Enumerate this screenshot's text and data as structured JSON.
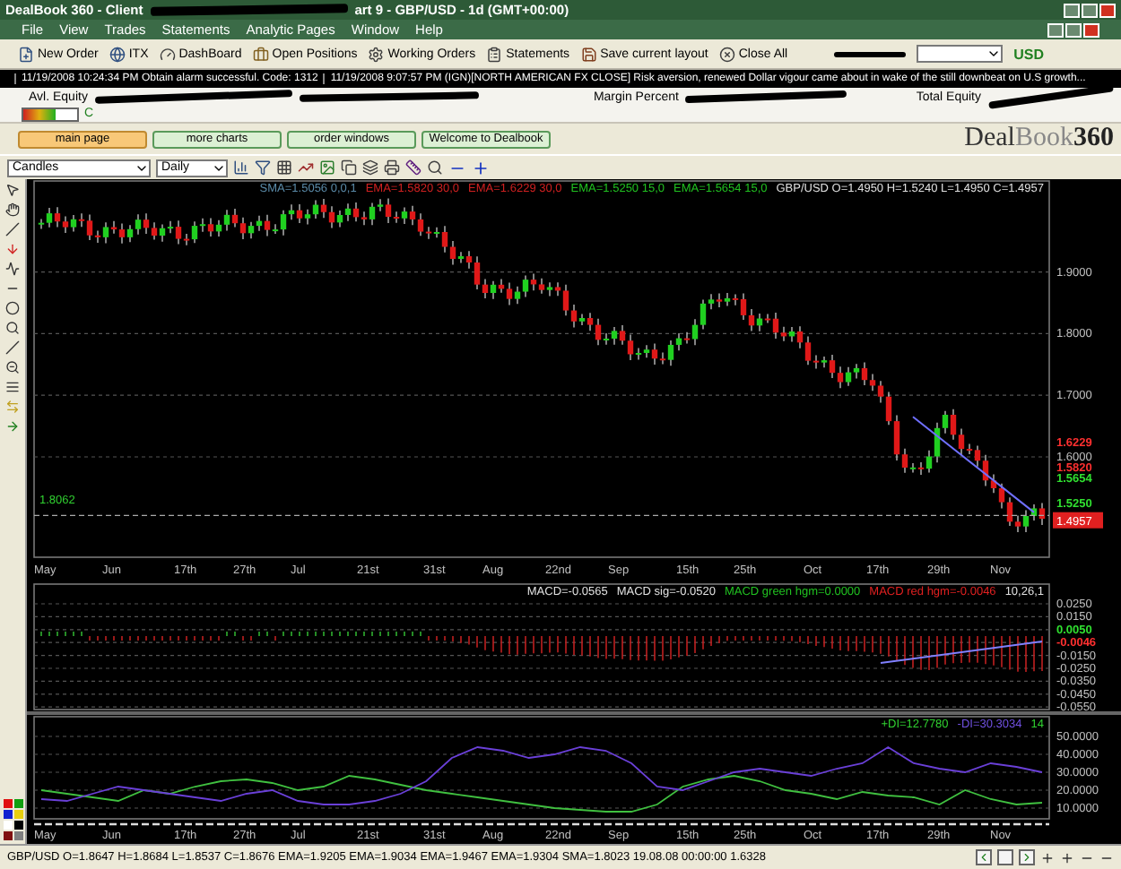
{
  "window": {
    "title_left": "DealBook 360 - Client",
    "title_right": "art 9 - GBP/USD - 1d (GMT+00:00)"
  },
  "menu": [
    "File",
    "View",
    "Trades",
    "Statements",
    "Analytic Pages",
    "Window",
    "Help"
  ],
  "toolbar": [
    {
      "label": "New Order",
      "kind": "order"
    },
    {
      "label": "ITX",
      "kind": "globe"
    },
    {
      "label": "DashBoard",
      "kind": "gauge"
    },
    {
      "label": "Open Positions",
      "kind": "briefcase"
    },
    {
      "label": "Working Orders",
      "kind": "gear"
    },
    {
      "label": "Statements",
      "kind": "clipboard"
    },
    {
      "label": "Save current layout",
      "kind": "save"
    },
    {
      "label": "Close All",
      "kind": "close"
    }
  ],
  "currency": "USD",
  "news": [
    "11/19/2008 10:24:34 PM Obtain alarm successful. Code: 1312",
    "11/19/2008 9:07:57 PM (IGN)[NORTH AMERICAN FX CLOSE] Risk aversion, renewed Dollar vigour came      about in wake of the still downbeat on U.S growth..."
  ],
  "account": {
    "left": [
      "Avl. Equity",
      "Margin Percent"
    ],
    "right": "Total Equity"
  },
  "connection": {
    "level": 0.6,
    "letter": "C"
  },
  "pages": [
    {
      "label": "main page",
      "selected": true
    },
    {
      "label": "more charts",
      "selected": false
    },
    {
      "label": "order windows",
      "selected": false
    },
    {
      "label": "Welcome to Dealbook",
      "selected": false
    }
  ],
  "logo": {
    "a": "Deal",
    "b": "Book",
    "c": "360"
  },
  "chart_toolbar": {
    "chart_type": "Candles",
    "period": "Daily"
  },
  "palette": [
    {
      "color": "#e01010"
    },
    {
      "color": "#10a010"
    },
    {
      "color": "#1020d0"
    },
    {
      "color": "#e8d010"
    },
    {
      "color": "#ffffff"
    },
    {
      "color": "#000000"
    },
    {
      "color": "#801010"
    },
    {
      "color": "#808080"
    }
  ],
  "price_chart": {
    "legend": [
      {
        "text": "SMA=1.5056 0,0,1",
        "color": "#5a8aa8"
      },
      {
        "text": "EMA=1.5820 30,0",
        "color": "#d02020"
      },
      {
        "text": "EMA=1.6229 30,0",
        "color": "#d02020"
      },
      {
        "text": "EMA=1.5250 15,0",
        "color": "#20c020"
      },
      {
        "text": "EMA=1.5654 15,0",
        "color": "#20c020"
      },
      {
        "text": "GBP/USD O=1.4950 H=1.5240 L=1.4950 C=1.4957",
        "color": "#e0e0e0"
      }
    ],
    "y_labels": [
      {
        "text": "1.9000",
        "kind": "grid"
      },
      {
        "text": "1.8000",
        "kind": "grid"
      },
      {
        "text": "1.7000",
        "kind": "grid"
      },
      {
        "text": "1.6229",
        "kind": "tag",
        "color": "#ff3030"
      },
      {
        "text": "1.6000",
        "kind": "grid"
      },
      {
        "text": "1.5820",
        "kind": "tag",
        "color": "#ff3030"
      },
      {
        "text": "1.5654",
        "kind": "tag",
        "color": "#30e030"
      },
      {
        "text": "1.5250",
        "kind": "tag",
        "color": "#30e030"
      },
      {
        "text": "1.4957",
        "kind": "box",
        "color": "#e02020"
      }
    ],
    "left_label": "1.8062",
    "x_labels": [
      "May",
      "Jun",
      "17th",
      "27th",
      "Jul",
      "21st",
      "31st",
      "Aug",
      "22nd",
      "Sep",
      "15th",
      "25th",
      "Oct",
      "17th",
      "29th",
      "Nov"
    ]
  },
  "macd_chart": {
    "legend": [
      {
        "text": "MACD=-0.0565",
        "color": "#e0e0e0"
      },
      {
        "text": "MACD sig=-0.0520",
        "color": "#e0e0e0"
      },
      {
        "text": "MACD green hgm=0.0000",
        "color": "#20c020"
      },
      {
        "text": "MACD red hgm=-0.0046",
        "color": "#e02020"
      },
      {
        "text": "10,26,1",
        "color": "#e0e0e0"
      }
    ],
    "y_labels": [
      {
        "text": "0.0250",
        "kind": "grid"
      },
      {
        "text": "0.0150",
        "kind": "grid"
      },
      {
        "text": "0.0050",
        "kind": "tag",
        "color": "#30e030"
      },
      {
        "text": "-0.0046",
        "kind": "tag",
        "color": "#ff3030"
      },
      {
        "text": "-0.0150",
        "kind": "grid"
      },
      {
        "text": "-0.0250",
        "kind": "grid"
      },
      {
        "text": "-0.0350",
        "kind": "grid"
      },
      {
        "text": "-0.0450",
        "kind": "grid"
      },
      {
        "text": "-0.0550",
        "kind": "grid"
      }
    ]
  },
  "di_chart": {
    "legend": [
      {
        "text": "+DI=12.7780",
        "color": "#30d030"
      },
      {
        "text": "-DI=30.3034",
        "color": "#7050e0"
      },
      {
        "text": "14",
        "color": "#30d030"
      }
    ],
    "chart_data": {
      "type": "line",
      "ylim": [
        5,
        61
      ],
      "yticks": [
        {
          "value": 50,
          "label": "50.0000"
        },
        {
          "value": 40,
          "label": "40.0000"
        },
        {
          "value": 30,
          "label": "30.0000"
        },
        {
          "value": 20,
          "label": "20.0000"
        },
        {
          "value": 10,
          "label": "10.0000"
        }
      ],
      "series": [
        {
          "color": "#40c040",
          "values": [
            20,
            18,
            16,
            14,
            20,
            18,
            22,
            25,
            26,
            24,
            20,
            22,
            28,
            26,
            23,
            20,
            18,
            16,
            14,
            12,
            10,
            9,
            8,
            8,
            12,
            22,
            26,
            28,
            25,
            20,
            18,
            15,
            19,
            17,
            16,
            12,
            20,
            15,
            12,
            13
          ]
        },
        {
          "color": "#6a40d8",
          "values": [
            15,
            14,
            18,
            22,
            20,
            18,
            16,
            14,
            18,
            20,
            14,
            12,
            12,
            14,
            18,
            25,
            38,
            44,
            42,
            38,
            40,
            44,
            42,
            35,
            22,
            20,
            25,
            30,
            32,
            30,
            28,
            32,
            35,
            44,
            35,
            32,
            30,
            35,
            33,
            30
          ]
        }
      ]
    },
    "x_labels": [
      "May",
      "Jun",
      "17th",
      "27th",
      "Jul",
      "21st",
      "31st",
      "Aug",
      "22nd",
      "Sep",
      "15th",
      "25th",
      "Oct",
      "17th",
      "29th",
      "Nov"
    ]
  },
  "status_bar": {
    "text": "GBP/USD O=1.8647 H=1.8684 L=1.8537 C=1.8676  EMA=1.9205 EMA=1.9034 EMA=1.9467 EMA=1.9304 SMA=1.8023  19.08.08 00:00:00 1.6328"
  }
}
